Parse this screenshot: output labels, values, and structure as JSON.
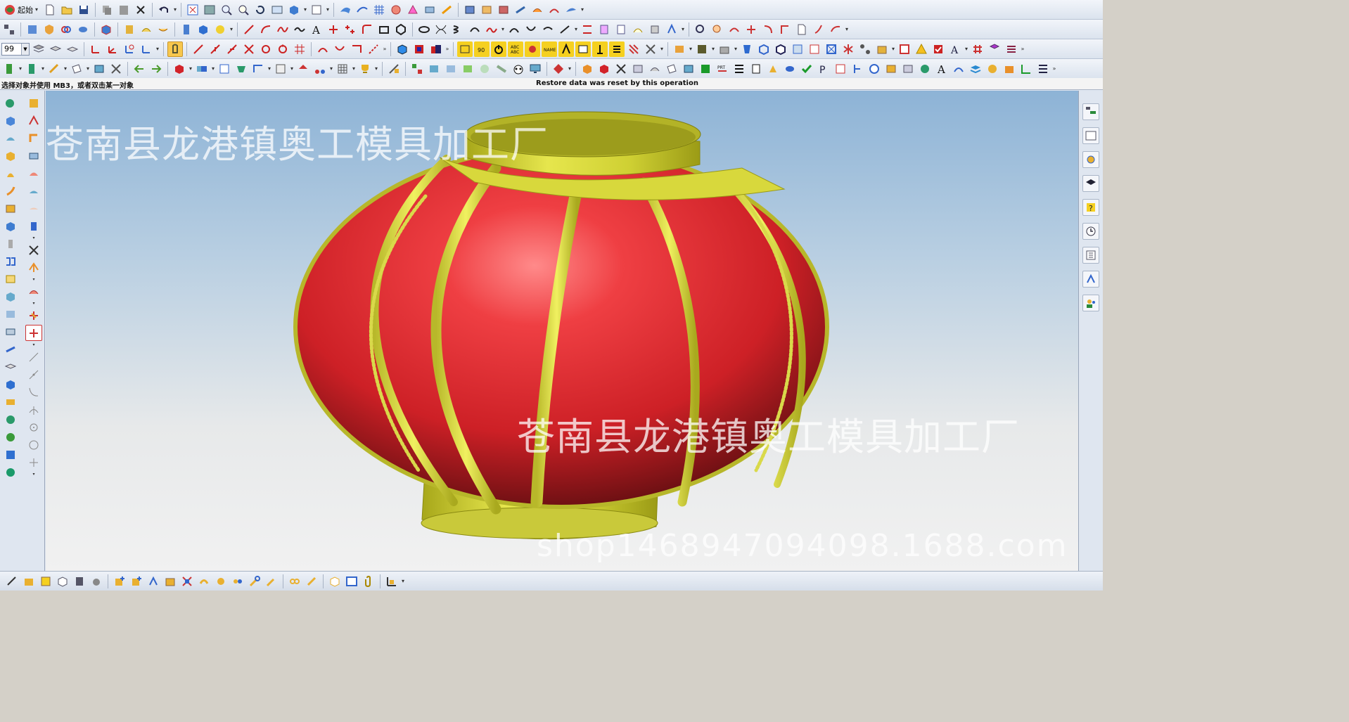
{
  "toolbar": {
    "start_label": "起始",
    "layer_value": "99"
  },
  "status": {
    "prompt": "选择对象并使用 MB3，或者双击某一对象",
    "message": "Restore data was reset by this operation"
  },
  "watermark": {
    "company_top": "苍南县龙港镇奥工模具加工厂",
    "company_bottom": "苍南县龙港镇奥工模具加工厂",
    "shop_url": "shop1468947094098.1688.com"
  },
  "model": {
    "body_color": "#d8252c",
    "rib_color": "#cfd033",
    "ribs": 8
  },
  "colors": {
    "toolbar_bg": "#dbe3ee",
    "viewport_top": "#8db3d6",
    "viewport_bottom": "#f1f1f1"
  }
}
